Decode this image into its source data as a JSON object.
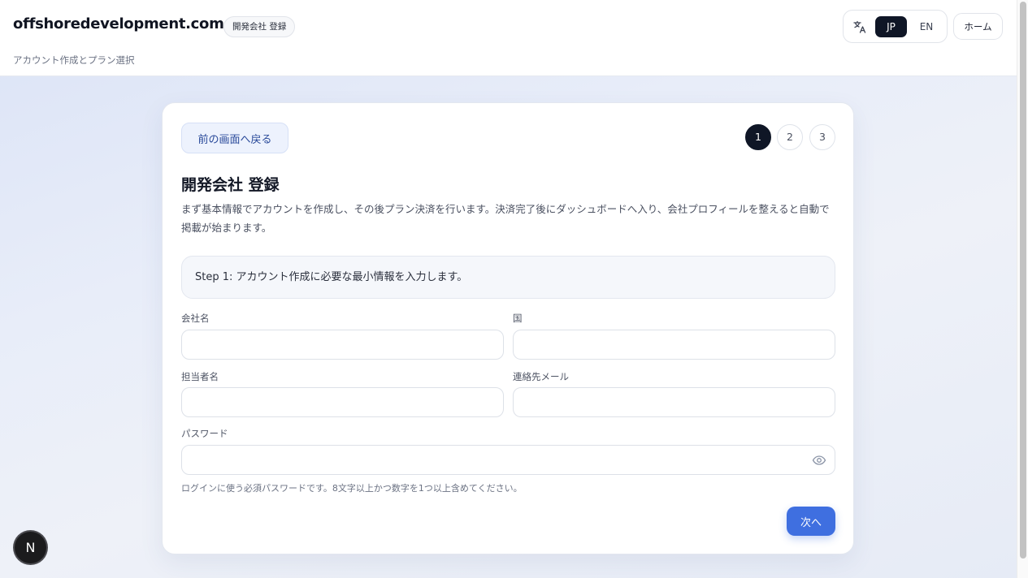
{
  "header": {
    "brand": "offshoredevelopment.com",
    "badge": "開発会社 登録",
    "subtitle": "アカウント作成とプラン選択",
    "language": {
      "icon": "translate-icon",
      "options": [
        "JP",
        "EN"
      ],
      "selected": "JP"
    },
    "home_label": "ホーム"
  },
  "card": {
    "back_label": "前の画面へ戻る",
    "steps": [
      "1",
      "2",
      "3"
    ],
    "current_step": 1,
    "title": "開発会社 登録",
    "description": "まず基本情報でアカウントを作成し、その後プラン決済を行います。決済完了後にダッシュボードへ入り、会社プロフィールを整えると自動で掲載が始まります。",
    "step_note": "Step 1: アカウント作成に必要な最小情報を入力します。",
    "fields": {
      "company_name": {
        "label": "会社名",
        "value": ""
      },
      "country": {
        "label": "国",
        "value": ""
      },
      "contact_name": {
        "label": "担当者名",
        "value": ""
      },
      "contact_email": {
        "label": "連絡先メール",
        "value": ""
      },
      "password": {
        "label": "パスワード",
        "value": "",
        "icon": "eye-icon"
      }
    },
    "password_hint": "ログインに使う必須パスワードです。8文字以上かつ数字を1つ以上含めてください。",
    "next_label": "次へ"
  },
  "floating_badge": {
    "label": "N"
  },
  "colors": {
    "accent": "#3f6fe0",
    "dark": "#0f1626",
    "back_button_bg": "#edf2fd"
  }
}
